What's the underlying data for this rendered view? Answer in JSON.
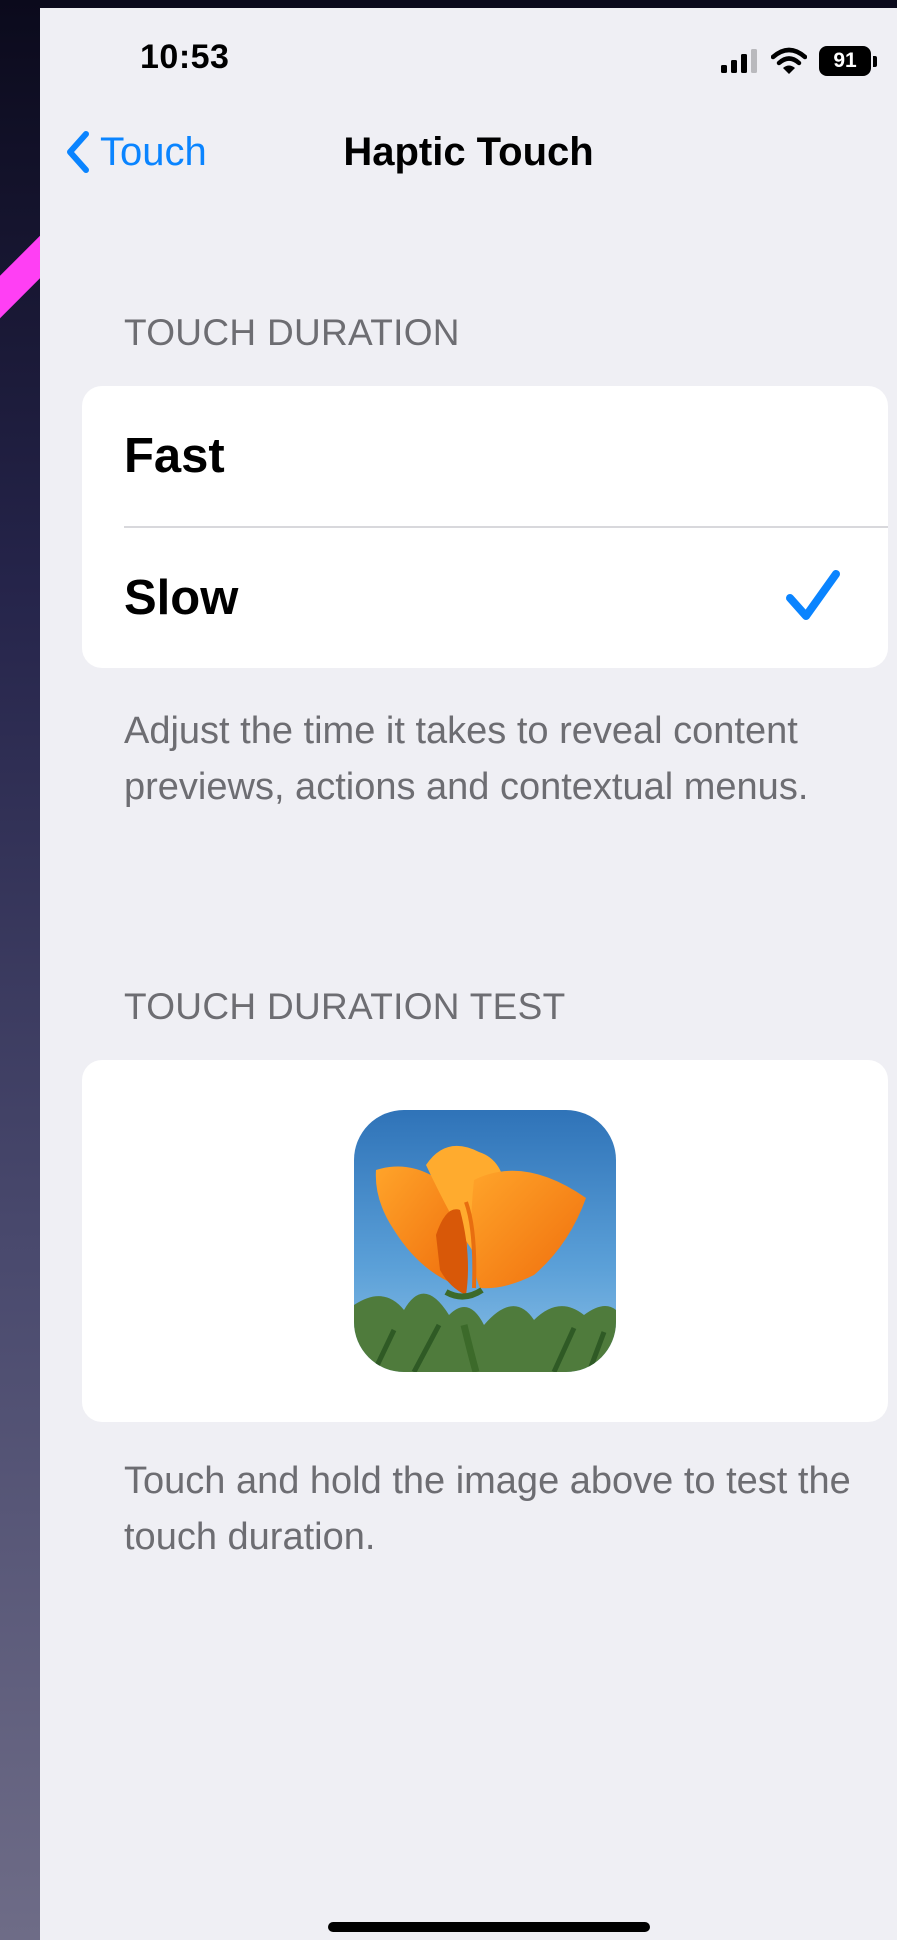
{
  "status_bar": {
    "time": "10:53",
    "battery": "91",
    "icons": [
      "signal-icon",
      "wifi-icon",
      "battery-icon"
    ]
  },
  "nav": {
    "back_label": "Touch",
    "title": "Haptic Touch"
  },
  "touch_duration": {
    "header": "TOUCH DURATION",
    "options": [
      {
        "label": "Fast",
        "selected": false
      },
      {
        "label": "Slow",
        "selected": true
      }
    ],
    "footer": "Adjust the time it takes to reveal content previews, actions and contextual menus."
  },
  "test_section": {
    "header": "TOUCH DURATION TEST",
    "footer": "Touch and hold the image above to test the touch duration."
  },
  "colors": {
    "accent": "#0a84ff",
    "background": "#efeff4",
    "secondary_text": "#6d6d72",
    "annotation_stroke": "#ff3ff4"
  }
}
